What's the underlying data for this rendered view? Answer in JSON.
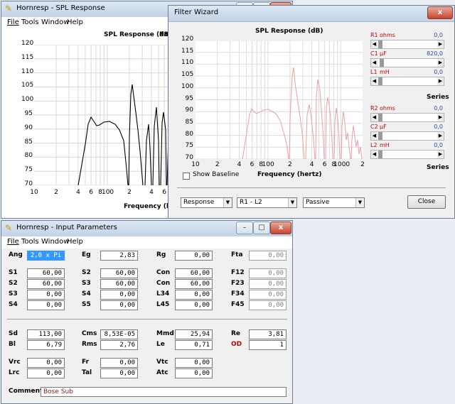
{
  "spl_window": {
    "title": "Hornresp - SPL Response",
    "menu": [
      "File",
      "Tools",
      "Window",
      "Help"
    ],
    "plot_title": "SPL Response (dB)",
    "plot_title_suffix": "Pat",
    "y_ticks": [
      "120",
      "115",
      "110",
      "105",
      "100",
      "95",
      "90",
      "85",
      "80",
      "75",
      "70"
    ],
    "x_ticks": [
      "10",
      "2",
      "4",
      "6",
      "8",
      "100",
      "2",
      "4",
      "6"
    ],
    "x_label": "Frequency (hertz)"
  },
  "filter_wizard": {
    "title": "Filter Wizard",
    "plot_title": "SPL Response (dB)",
    "y_ticks": [
      "120",
      "115",
      "110",
      "105",
      "100",
      "95",
      "90",
      "85",
      "80",
      "75",
      "70"
    ],
    "x_ticks": [
      "10",
      "2",
      "4",
      "6",
      "8",
      "100",
      "2",
      "4",
      "6",
      "8",
      "1000",
      "2"
    ],
    "x_label": "Frequency (hertz)",
    "show_baseline": "Show Baseline",
    "sliders": [
      {
        "name": "R1",
        "unit": "ohms",
        "value": "0,0"
      },
      {
        "name": "C1",
        "unit": "µF",
        "value": "820,0"
      },
      {
        "name": "L1",
        "unit": "mH",
        "value": "0,0"
      },
      {
        "name": "R2",
        "unit": "ohms",
        "value": "0,0"
      },
      {
        "name": "C2",
        "unit": "µF",
        "value": "0,0"
      },
      {
        "name": "L2",
        "unit": "mH",
        "value": "0,0"
      }
    ],
    "series_labels": [
      "Series",
      "Series"
    ],
    "combo_response": "Response",
    "combo_circuit": "R1 - L2",
    "combo_type": "Passive",
    "close_label": "Close",
    "colors": {
      "curve": "#e8a8a8",
      "grid": "#dcdcdc",
      "value_text": "#2e4aa8"
    }
  },
  "input_window": {
    "title": "Hornresp - Input Parameters",
    "menu": [
      "File",
      "Tools",
      "Window",
      "Help"
    ],
    "rows1": [
      [
        [
          "Ang",
          "2,0 x Pi",
          "sel"
        ],
        [
          "Eg",
          "2,83",
          ""
        ],
        [
          "Rg",
          "0,00",
          ""
        ],
        [
          "Fta",
          "0,00",
          "dis"
        ]
      ],
      [
        [
          "S1",
          "60,00",
          ""
        ],
        [
          "S2",
          "60,00",
          ""
        ],
        [
          "Con",
          "60,00",
          ""
        ],
        [
          "F12",
          "0,00",
          "dis"
        ]
      ],
      [
        [
          "S2",
          "60,00",
          ""
        ],
        [
          "S3",
          "60,00",
          ""
        ],
        [
          "Con",
          "60,00",
          ""
        ],
        [
          "F23",
          "0,00",
          "dis"
        ]
      ],
      [
        [
          "S3",
          "0,00",
          ""
        ],
        [
          "S4",
          "0,00",
          ""
        ],
        [
          "L34",
          "0,00",
          ""
        ],
        [
          "F34",
          "0,00",
          "dis"
        ]
      ],
      [
        [
          "S4",
          "0,00",
          ""
        ],
        [
          "S5",
          "0,00",
          ""
        ],
        [
          "L45",
          "0,00",
          ""
        ],
        [
          "F45",
          "0,00",
          "dis"
        ]
      ]
    ],
    "rows2": [
      [
        [
          "Sd",
          "113,00",
          ""
        ],
        [
          "Cms",
          "8,53E-05",
          ""
        ],
        [
          "Mmd",
          "25,94",
          ""
        ],
        [
          "Re",
          "3,81",
          ""
        ]
      ],
      [
        [
          "Bl",
          "6,79",
          ""
        ],
        [
          "Rms",
          "2,76",
          ""
        ],
        [
          "Le",
          "0,71",
          ""
        ],
        [
          "OD",
          "1",
          "od"
        ]
      ]
    ],
    "rows3": [
      [
        [
          "Vrc",
          "0,00",
          ""
        ],
        [
          "Fr",
          "0,00",
          ""
        ],
        [
          "Vtc",
          "0,00",
          ""
        ]
      ],
      [
        [
          "Lrc",
          "0,00",
          ""
        ],
        [
          "Tal",
          "0,00",
          ""
        ],
        [
          "Atc",
          "0,00",
          ""
        ]
      ]
    ],
    "comment_label": "Comment",
    "comment_value": "Bose Sub",
    "colors": {
      "od": "#c00000",
      "comment": "#8b1a1a"
    }
  }
}
